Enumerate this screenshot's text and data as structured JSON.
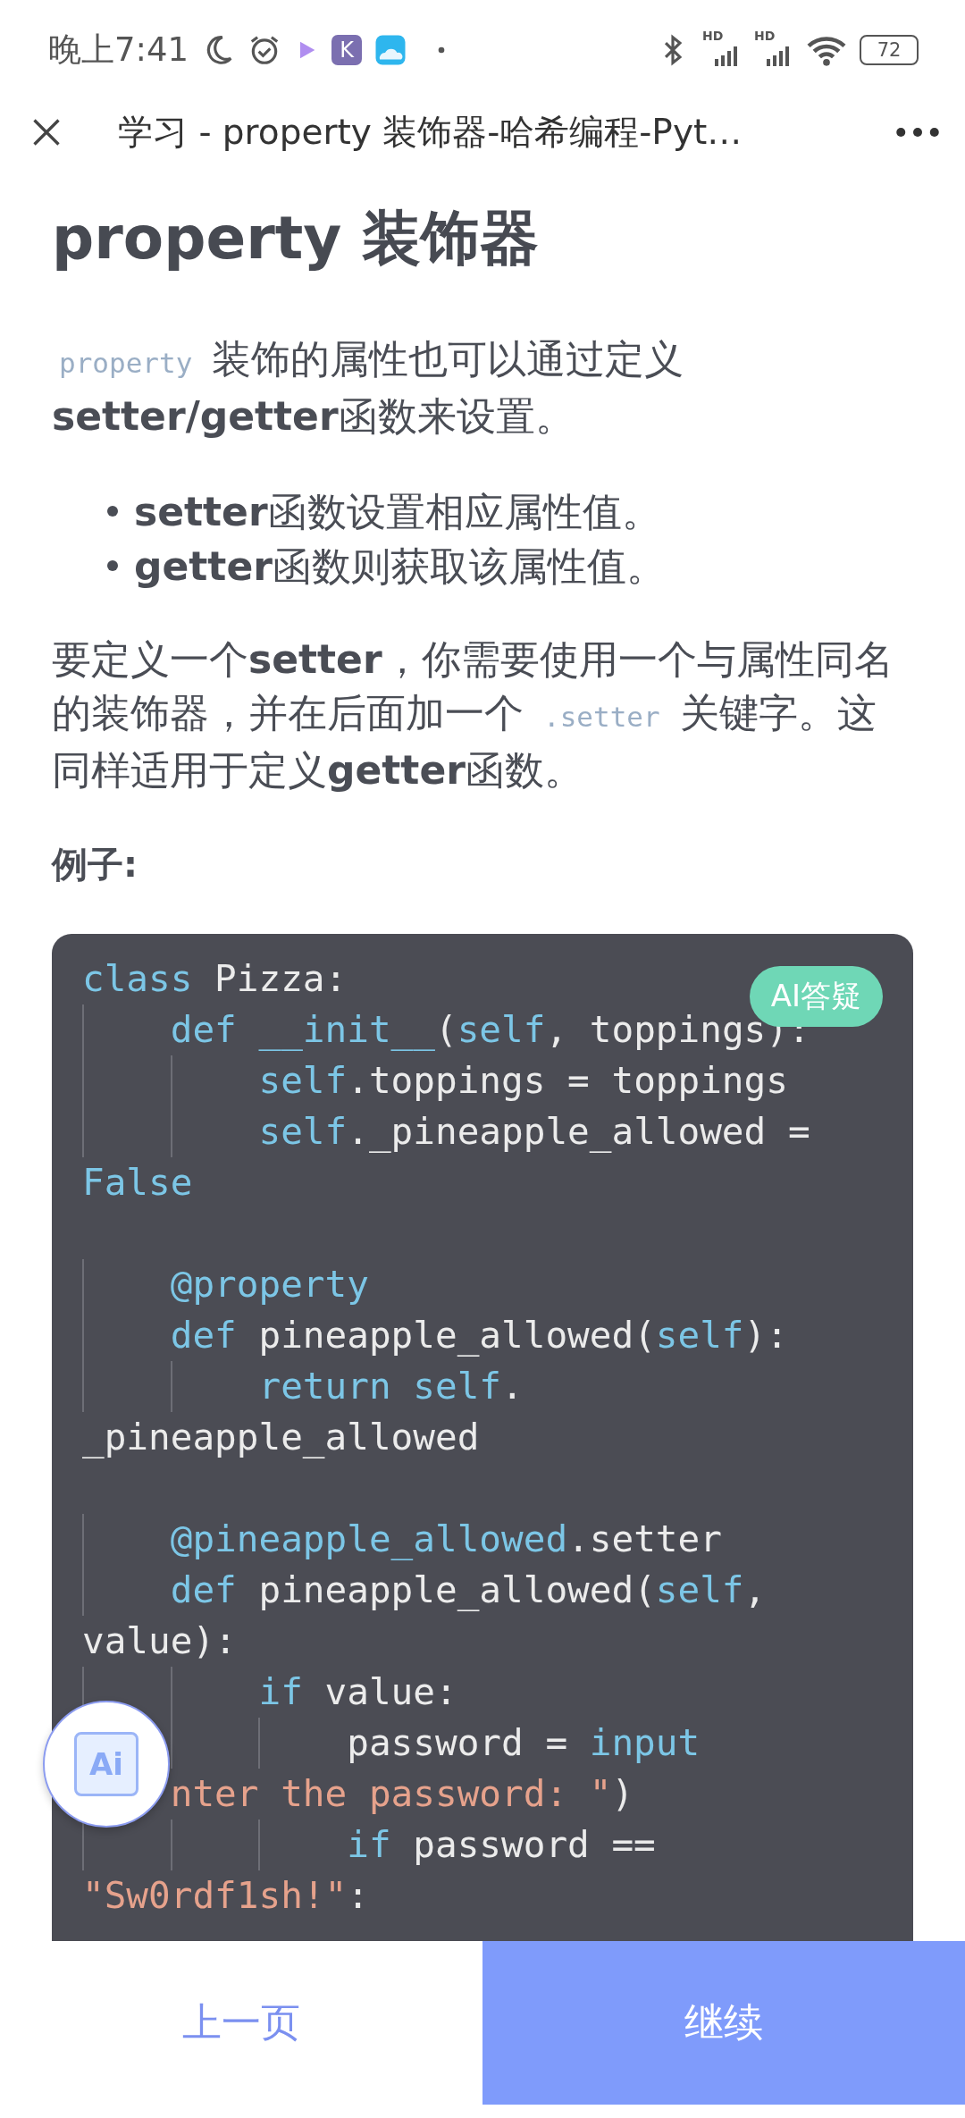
{
  "status_bar": {
    "time": "晚上7:41",
    "app_badge": "K",
    "signal_labels": [
      "HD",
      "HD"
    ],
    "battery": "72"
  },
  "title_bar": {
    "title": "学习 - property 装饰器-哈希编程-Pyt…"
  },
  "heading": "property 装饰器",
  "intro": [
    {
      "kind": "code",
      "text": "property"
    },
    {
      "kind": "text",
      "text": " 装饰的属性也可以通过定义**setter/getter**函数来设置。"
    }
  ],
  "bullets": [
    "**setter**函数设置相应属性值。",
    "**getter**函数则获取该属性值。"
  ],
  "paragraph": [
    {
      "kind": "text",
      "text": "要定义一个**setter**，你需要使用一个与属性同名的装饰器，并在后面加一个 "
    },
    {
      "kind": "code",
      "text": ".setter"
    },
    {
      "kind": "text",
      "text": " 关键字。这同样适用于定义**getter**函数。"
    }
  ],
  "example_label": "例子:",
  "code_badge": "AI答疑",
  "code_lines": [
    {
      "kind": "code",
      "tokens": [
        {
          "text": "class",
          "kind": "keyword"
        },
        {
          "text": " Pizza:",
          "kind": "plain"
        }
      ]
    },
    {
      "kind": "code",
      "tokens": [
        {
          "text": "    def __init__",
          "kind": "keyword"
        },
        {
          "text": "(",
          "kind": "plain"
        },
        {
          "text": "self",
          "kind": "keyword"
        },
        {
          "text": ", toppings):",
          "kind": "plain"
        }
      ]
    },
    {
      "kind": "code",
      "tokens": [
        {
          "text": "        self",
          "kind": "keyword"
        },
        {
          "text": ".toppings = toppings",
          "kind": "plain"
        }
      ]
    },
    {
      "kind": "code",
      "tokens": [
        {
          "text": "        self",
          "kind": "keyword"
        },
        {
          "text": "._pineapple_allowed =",
          "kind": "plain"
        }
      ]
    },
    {
      "kind": "code",
      "tokens": [
        {
          "text": "False",
          "kind": "keyword"
        }
      ]
    },
    {
      "kind": "blank"
    },
    {
      "kind": "code",
      "tokens": [
        {
          "text": "    @property",
          "kind": "keyword"
        }
      ]
    },
    {
      "kind": "code",
      "tokens": [
        {
          "text": "    def",
          "kind": "keyword"
        },
        {
          "text": " pineapple_allowed(",
          "kind": "plain"
        },
        {
          "text": "self",
          "kind": "keyword"
        },
        {
          "text": "):",
          "kind": "plain"
        }
      ]
    },
    {
      "kind": "code",
      "tokens": [
        {
          "text": "        return self",
          "kind": "keyword"
        },
        {
          "text": ".",
          "kind": "plain"
        }
      ]
    },
    {
      "kind": "code",
      "tokens": [
        {
          "text": "_pineapple_allowed",
          "kind": "plain"
        }
      ]
    },
    {
      "kind": "blank"
    },
    {
      "kind": "code",
      "tokens": [
        {
          "text": "    @pineapple_allowed",
          "kind": "keyword"
        },
        {
          "text": ".setter",
          "kind": "plain"
        }
      ]
    },
    {
      "kind": "code",
      "tokens": [
        {
          "text": "    def",
          "kind": "keyword"
        },
        {
          "text": " pineapple_allowed(",
          "kind": "plain"
        },
        {
          "text": "self",
          "kind": "keyword"
        },
        {
          "text": ",",
          "kind": "plain"
        }
      ]
    },
    {
      "kind": "code",
      "tokens": [
        {
          "text": "value):",
          "kind": "plain"
        }
      ]
    },
    {
      "kind": "code",
      "tokens": [
        {
          "text": "        if",
          "kind": "keyword"
        },
        {
          "text": " value:",
          "kind": "plain"
        }
      ]
    },
    {
      "kind": "code",
      "tokens": [
        {
          "text": "            password = ",
          "kind": "plain"
        },
        {
          "text": "input",
          "kind": "keyword"
        }
      ]
    },
    {
      "kind": "code",
      "tokens": [
        {
          "text": "    nter the password: \"",
          "kind": "string"
        },
        {
          "text": ")",
          "kind": "plain"
        }
      ]
    },
    {
      "kind": "code",
      "tokens": [
        {
          "text": "            if",
          "kind": "keyword"
        },
        {
          "text": " password ==",
          "kind": "plain"
        }
      ]
    },
    {
      "kind": "code",
      "tokens": [
        {
          "text": "\"Sw0rdf1sh!\"",
          "kind": "string"
        },
        {
          "text": ":",
          "kind": "plain"
        }
      ]
    }
  ],
  "floating_button": "Ai",
  "footer": {
    "prev": "上一页",
    "next": "继续"
  }
}
